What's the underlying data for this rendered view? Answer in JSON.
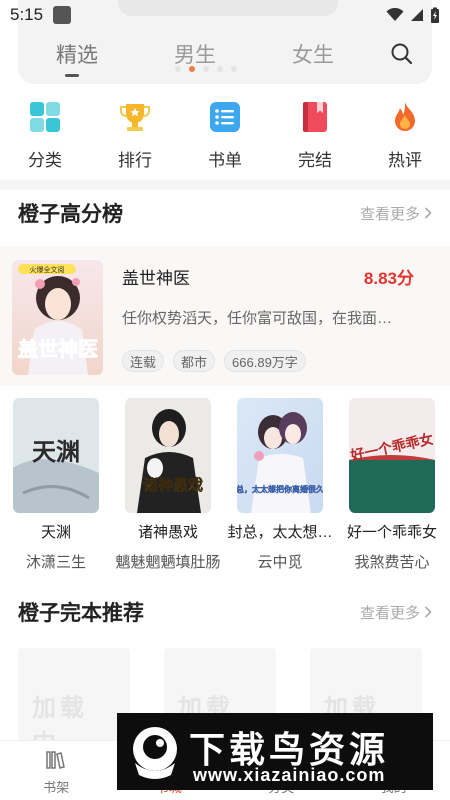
{
  "status_bar": {
    "time": "5:15"
  },
  "header": {
    "tabs": [
      {
        "label": "精选",
        "active": true
      },
      {
        "label": "男生",
        "active": false
      },
      {
        "label": "女生",
        "active": false
      }
    ],
    "search_icon": "search-icon",
    "carousel": {
      "count": 5,
      "active_index": 1
    }
  },
  "quick_nav": [
    {
      "label": "分类",
      "icon": "category-grid-icon",
      "color": "#3ac6d6"
    },
    {
      "label": "排行",
      "icon": "trophy-icon",
      "color": "#f5b62a"
    },
    {
      "label": "书单",
      "icon": "list-icon",
      "color": "#3da7f0"
    },
    {
      "label": "完结",
      "icon": "book-finished-icon",
      "color": "#ef4b5c"
    },
    {
      "label": "热评",
      "icon": "flame-icon",
      "color": "#f26a2b"
    }
  ],
  "high_score_section": {
    "title": "橙子高分榜",
    "more": "查看更多",
    "featured": {
      "name": "盖世神医",
      "score": "8.83分",
      "desc": "任你权势滔天，任你富可敌国，在我面…",
      "tags": [
        "连载",
        "都市",
        "666.89万字"
      ],
      "cover_text": "盖世神医",
      "cover_badge": "火爆全文阅"
    },
    "books": [
      {
        "title": "天渊",
        "author": "沐潇三生",
        "cover_text": "天渊"
      },
      {
        "title": "诸神愚戏",
        "author": "魑魅魍魉填肚肠",
        "cover_text": "诸神愚戏"
      },
      {
        "title": "封总，太太想…",
        "author": "云中觅",
        "cover_text": "封总，太太想把你离婚很久了"
      },
      {
        "title": "好一个乖乖女",
        "author": "我煞费苦心",
        "cover_text": "好一个乖乖女"
      }
    ]
  },
  "complete_section": {
    "title": "橙子完本推荐",
    "more": "查看更多",
    "placeholder_text": "加载中…"
  },
  "bottom_nav": [
    {
      "label": "书架",
      "icon": "bookshelf-icon",
      "active": false
    },
    {
      "label": "书城",
      "icon": "store-icon",
      "active": true
    },
    {
      "label": "分类",
      "icon": "category-icon",
      "active": false
    },
    {
      "label": "我的",
      "icon": "profile-icon",
      "active": false
    }
  ],
  "watermark": {
    "text": "下载鸟资源",
    "url": "www.xiazainiao.com"
  }
}
